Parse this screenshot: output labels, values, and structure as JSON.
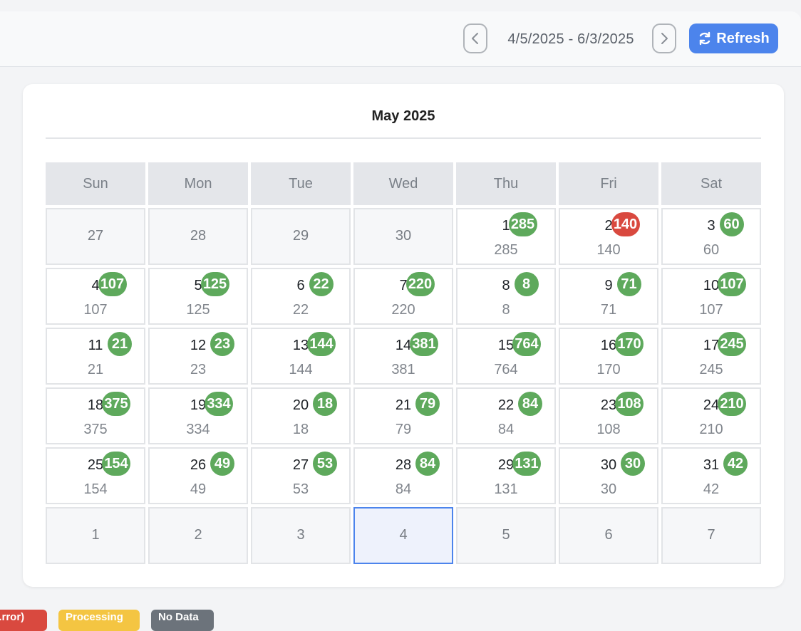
{
  "header": {
    "date_range": "4/5/2025 - 6/3/2025",
    "prev_icon": "chevron-left-icon",
    "next_icon": "chevron-right-icon",
    "refresh_label": "Refresh",
    "refresh_icon": "refresh-icon",
    "accent_color": "#4c84ec"
  },
  "calendar": {
    "month_title": "May 2025",
    "weekdays": [
      "Sun",
      "Mon",
      "Tue",
      "Wed",
      "Thu",
      "Fri",
      "Sat"
    ],
    "days": [
      {
        "day": "27",
        "other": true
      },
      {
        "day": "28",
        "other": true
      },
      {
        "day": "29",
        "other": true
      },
      {
        "day": "30",
        "other": true
      },
      {
        "day": "1",
        "count": "285",
        "status": "green"
      },
      {
        "day": "2",
        "count": "140",
        "status": "red"
      },
      {
        "day": "3",
        "count": "60",
        "status": "green"
      },
      {
        "day": "4",
        "count": "107",
        "status": "green"
      },
      {
        "day": "5",
        "count": "125",
        "status": "green"
      },
      {
        "day": "6",
        "count": "22",
        "status": "green"
      },
      {
        "day": "7",
        "count": "220",
        "status": "green"
      },
      {
        "day": "8",
        "count": "8",
        "status": "green"
      },
      {
        "day": "9",
        "count": "71",
        "status": "green"
      },
      {
        "day": "10",
        "count": "107",
        "status": "green"
      },
      {
        "day": "11",
        "count": "21",
        "status": "green"
      },
      {
        "day": "12",
        "count": "23",
        "status": "green"
      },
      {
        "day": "13",
        "count": "144",
        "status": "green"
      },
      {
        "day": "14",
        "count": "381",
        "status": "green"
      },
      {
        "day": "15",
        "count": "764",
        "status": "green"
      },
      {
        "day": "16",
        "count": "170",
        "status": "green"
      },
      {
        "day": "17",
        "count": "245",
        "status": "green"
      },
      {
        "day": "18",
        "count": "375",
        "status": "green"
      },
      {
        "day": "19",
        "count": "334",
        "status": "green"
      },
      {
        "day": "20",
        "count": "18",
        "status": "green"
      },
      {
        "day": "21",
        "count": "79",
        "status": "green"
      },
      {
        "day": "22",
        "count": "84",
        "status": "green"
      },
      {
        "day": "23",
        "count": "108",
        "status": "green"
      },
      {
        "day": "24",
        "count": "210",
        "status": "green"
      },
      {
        "day": "25",
        "count": "154",
        "status": "green"
      },
      {
        "day": "26",
        "count": "49",
        "status": "green"
      },
      {
        "day": "27",
        "count": "53",
        "status": "green"
      },
      {
        "day": "28",
        "count": "84",
        "status": "green"
      },
      {
        "day": "29",
        "count": "131",
        "status": "green"
      },
      {
        "day": "30",
        "count": "30",
        "status": "green"
      },
      {
        "day": "31",
        "count": "42",
        "status": "green"
      },
      {
        "day": "1",
        "other": true
      },
      {
        "day": "2",
        "other": true
      },
      {
        "day": "3",
        "other": true
      },
      {
        "day": "4",
        "other": true,
        "today": true
      },
      {
        "day": "5",
        "other": true
      },
      {
        "day": "6",
        "other": true
      },
      {
        "day": "7",
        "other": true
      }
    ],
    "status_colors": {
      "green": "#5ea95c",
      "red": "#d9493f"
    }
  },
  "legend": {
    "items": [
      {
        "label": "...rror)",
        "color": "#d9493f"
      },
      {
        "label": "Processing",
        "color": "#f4c542"
      },
      {
        "label": "No Data",
        "color": "#6c737b"
      }
    ]
  }
}
